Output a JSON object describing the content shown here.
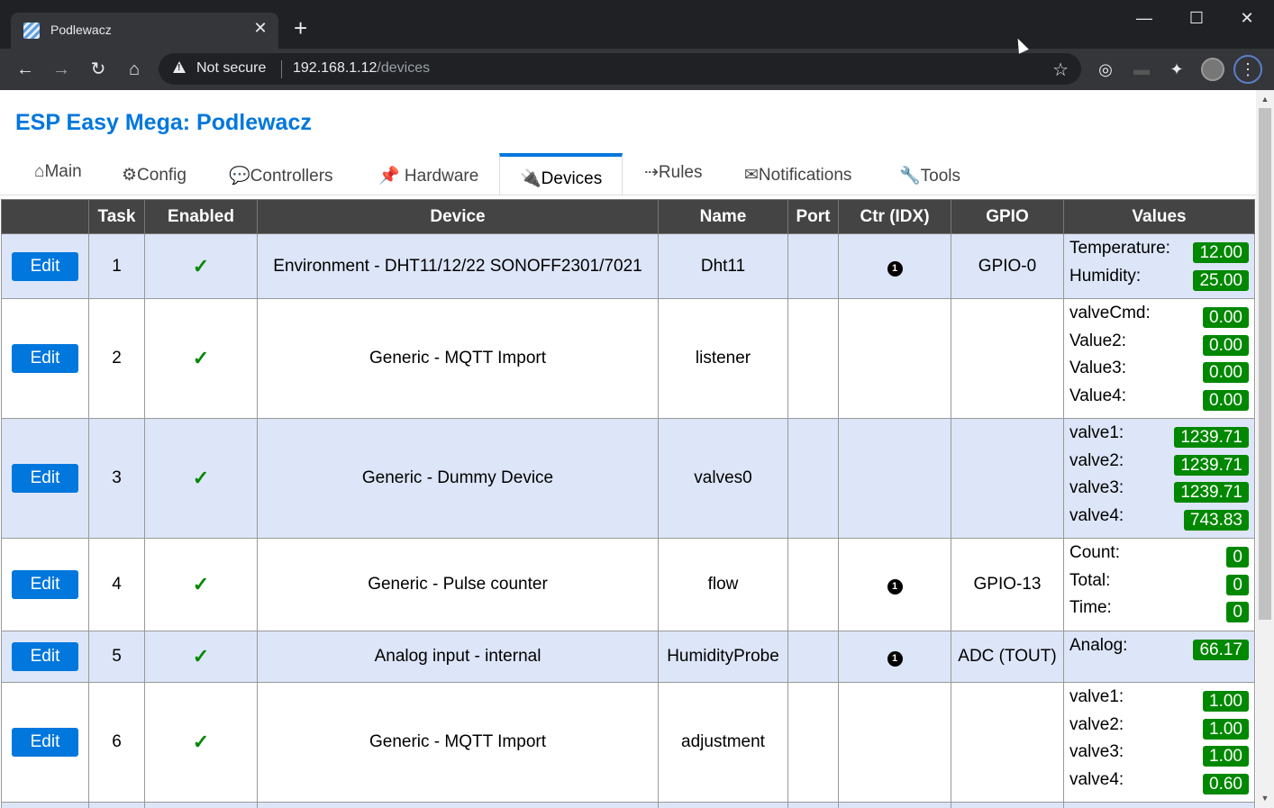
{
  "browser": {
    "tab_title": "Podlewacz",
    "tab_close": "✕",
    "new_tab": "+",
    "minimize": "—",
    "maximize": "☐",
    "close": "✕",
    "back": "←",
    "forward": "→",
    "reload": "↻",
    "home": "⌂",
    "not_secure": "Not secure",
    "url_host": "192.168.1.12",
    "url_path": "/devices",
    "bookmark": "☆",
    "ext1": "◎",
    "ext2": "▬",
    "ext3": "✦",
    "menu": "⋮"
  },
  "site": {
    "title": "ESP Easy Mega: Podlewacz"
  },
  "menu": [
    {
      "label": "⌂Main",
      "active": false
    },
    {
      "label": "⚙Config",
      "active": false
    },
    {
      "label": "💬Controllers",
      "active": false
    },
    {
      "label": "📌 Hardware",
      "active": false
    },
    {
      "label": "🔌Devices",
      "active": true
    },
    {
      "label": "⇢Rules",
      "active": false
    },
    {
      "label": "✉Notifications",
      "active": false
    },
    {
      "label": "🔧Tools",
      "active": false
    }
  ],
  "table": {
    "headers": [
      "",
      "Task",
      "Enabled",
      "Device",
      "Name",
      "Port",
      "Ctr (IDX)",
      "GPIO",
      "Values"
    ],
    "edit_label": "Edit",
    "check": "✓",
    "idx_label": "1",
    "rows": [
      {
        "task": "1",
        "device": "Environment - DHT11/12/22 SONOFF2301/7021",
        "name": "Dht11",
        "port": "",
        "idx": true,
        "gpio": "GPIO-0",
        "values": [
          {
            "name": "Temperature:",
            "value": "12.00"
          },
          {
            "name": "Humidity:",
            "value": "25.00"
          }
        ]
      },
      {
        "task": "2",
        "device": "Generic - MQTT Import",
        "name": "listener",
        "port": "",
        "idx": false,
        "gpio": "",
        "values": [
          {
            "name": "valveCmd:",
            "value": "0.00"
          },
          {
            "name": "Value2:",
            "value": "0.00"
          },
          {
            "name": "Value3:",
            "value": "0.00"
          },
          {
            "name": "Value4:",
            "value": "0.00"
          }
        ]
      },
      {
        "task": "3",
        "device": "Generic - Dummy Device",
        "name": "valves0",
        "port": "",
        "idx": false,
        "gpio": "",
        "values": [
          {
            "name": "valve1:",
            "value": "1239.71"
          },
          {
            "name": "valve2:",
            "value": "1239.71"
          },
          {
            "name": "valve3:",
            "value": "1239.71"
          },
          {
            "name": "valve4:",
            "value": "743.83"
          }
        ]
      },
      {
        "task": "4",
        "device": "Generic - Pulse counter",
        "name": "flow",
        "port": "",
        "idx": true,
        "gpio": "GPIO-13",
        "values": [
          {
            "name": "Count:",
            "value": "0"
          },
          {
            "name": "Total:",
            "value": "0"
          },
          {
            "name": "Time:",
            "value": "0"
          }
        ]
      },
      {
        "task": "5",
        "device": "Analog input - internal",
        "name": "HumidityProbe",
        "port": "",
        "idx": true,
        "gpio": "ADC (TOUT)",
        "values": [
          {
            "name": "Analog:",
            "value": "66.17"
          }
        ]
      },
      {
        "task": "6",
        "device": "Generic - MQTT Import",
        "name": "adjustment",
        "port": "",
        "idx": false,
        "gpio": "",
        "values": [
          {
            "name": "valve1:",
            "value": "1.00"
          },
          {
            "name": "valve2:",
            "value": "1.00"
          },
          {
            "name": "valve3:",
            "value": "1.00"
          },
          {
            "name": "valve4:",
            "value": "0.60"
          }
        ]
      }
    ]
  }
}
